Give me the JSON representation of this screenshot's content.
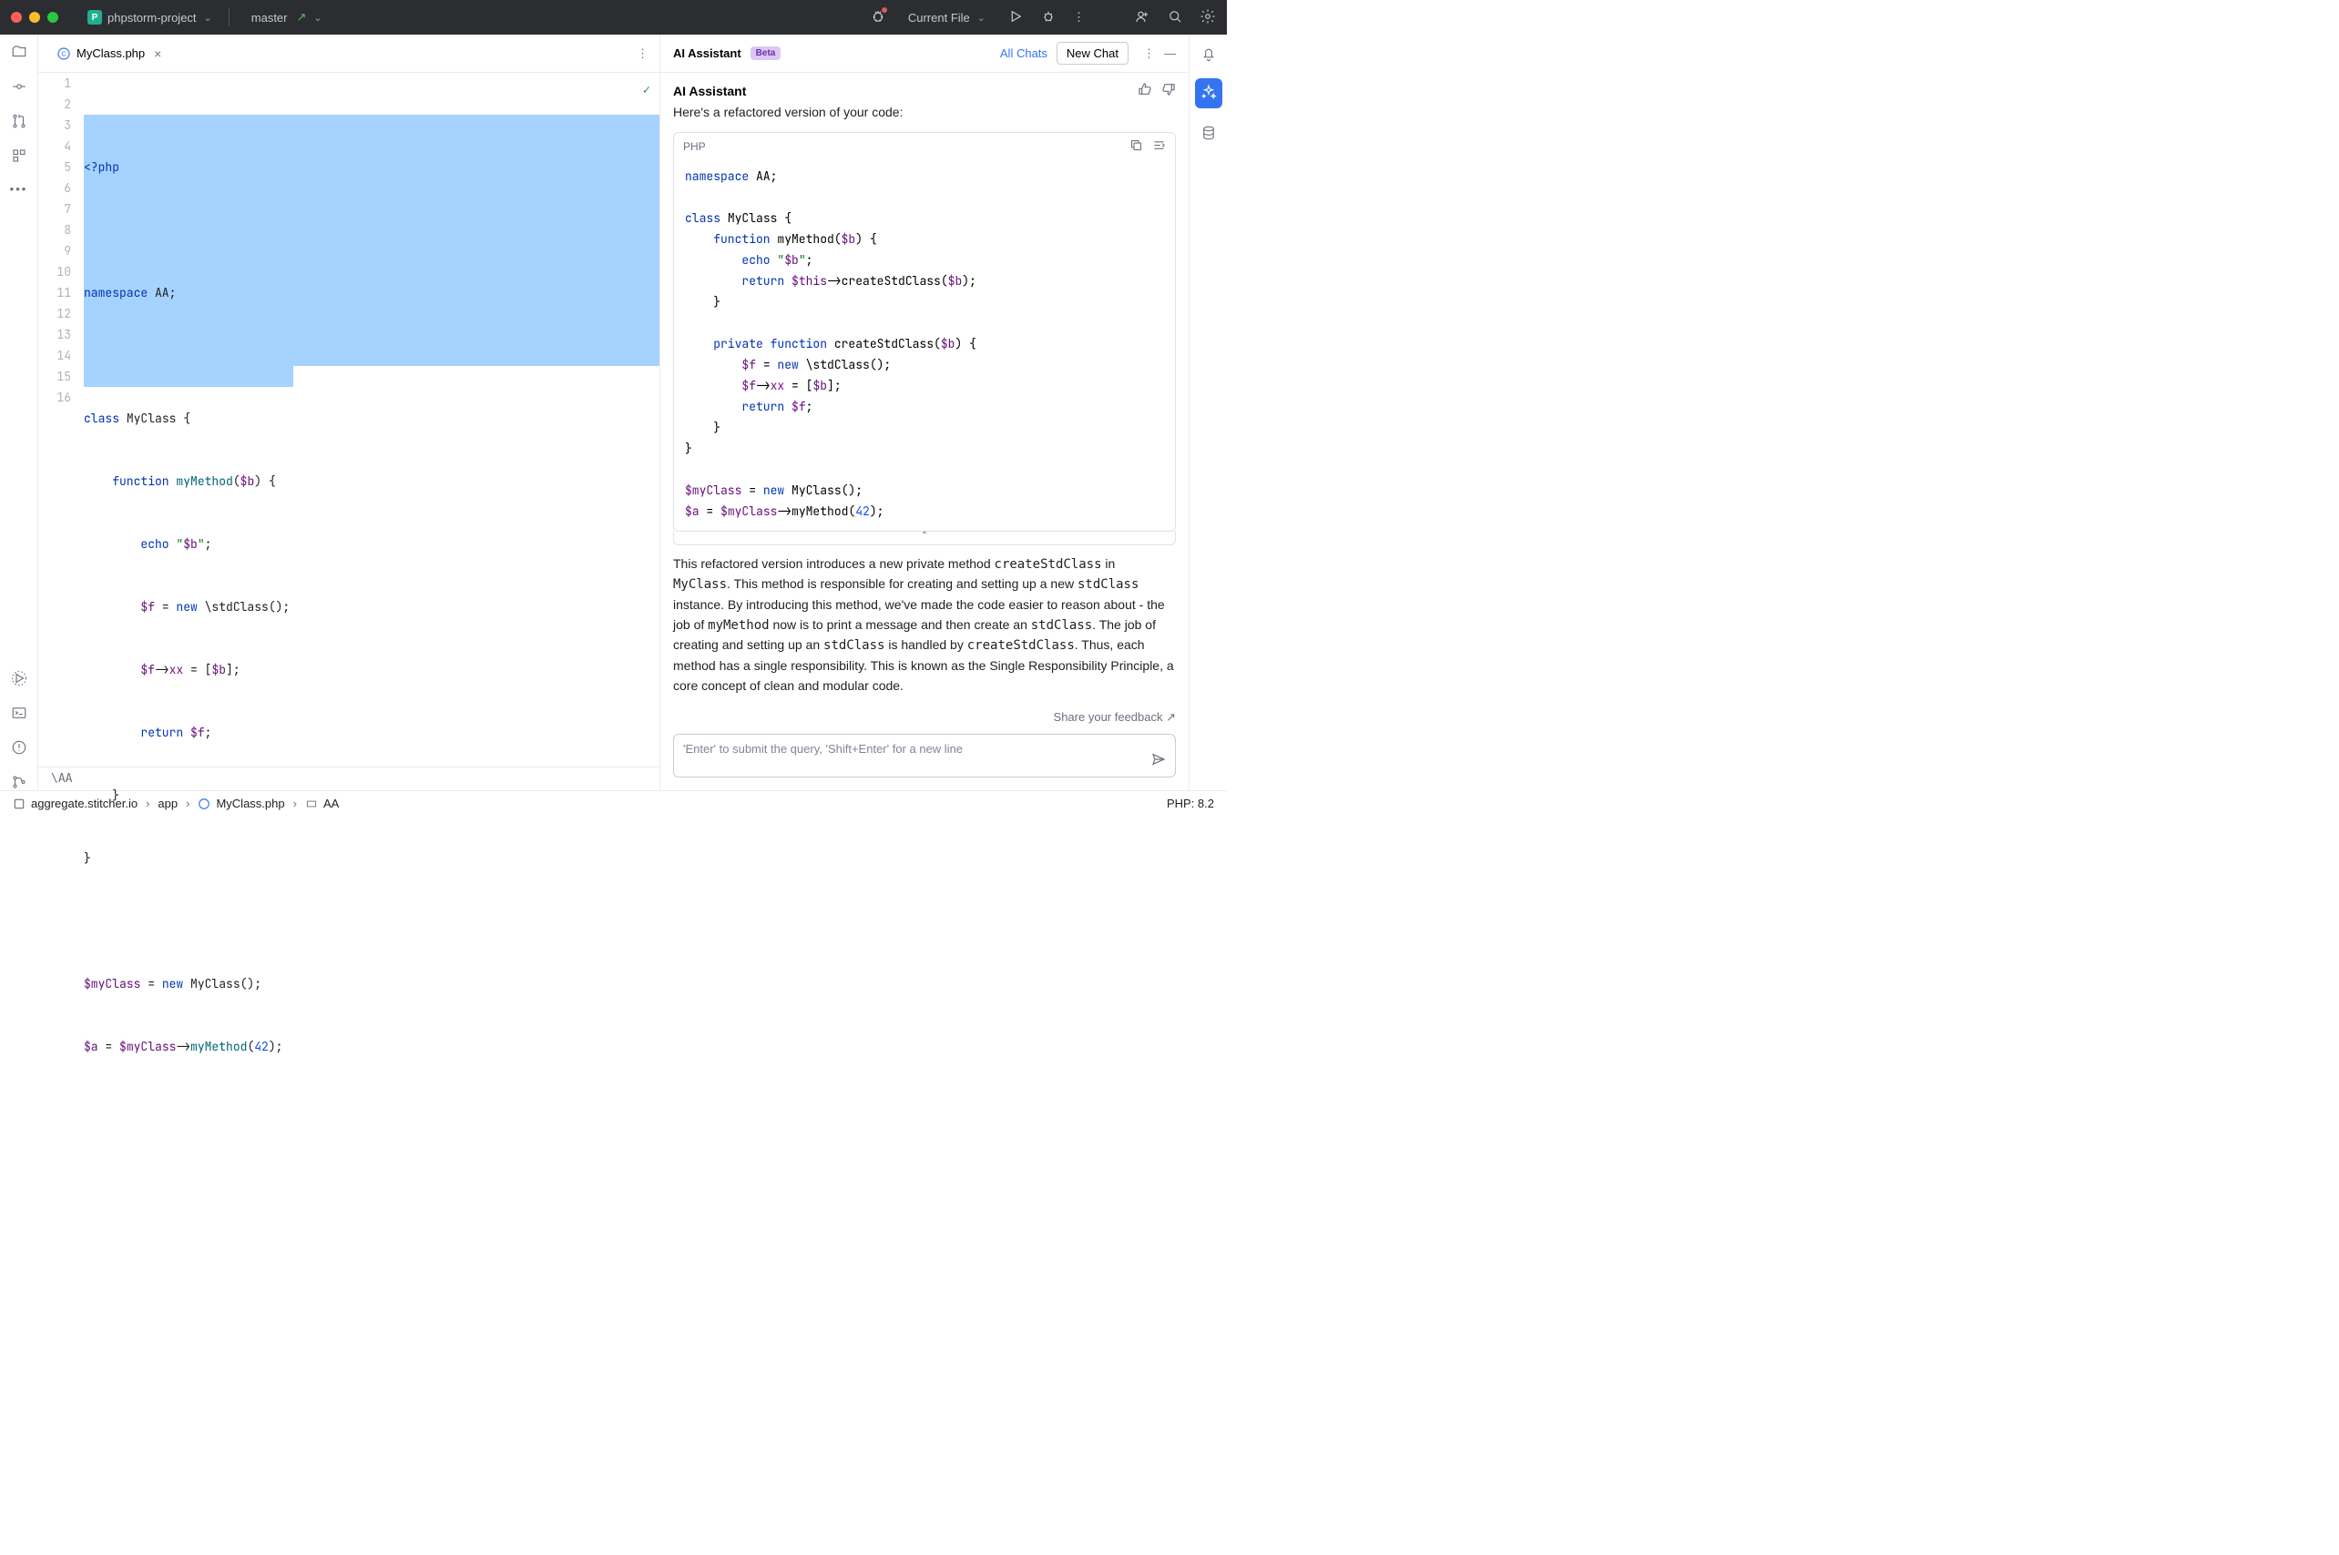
{
  "titlebar": {
    "project": "phpstorm-project",
    "branch": "master",
    "run_config": "Current File"
  },
  "editor": {
    "tab_filename": "MyClass.php",
    "line_numbers": [
      "1",
      "2",
      "3",
      "4",
      "5",
      "6",
      "7",
      "8",
      "9",
      "10",
      "11",
      "12",
      "13",
      "14",
      "15",
      "16"
    ],
    "code_lines": [
      {
        "t": "php_open",
        "text": "<?php"
      },
      {
        "t": "blank",
        "text": ""
      },
      {
        "t": "ns",
        "k": "namespace",
        "v": " AA;"
      },
      {
        "t": "blank",
        "text": ""
      },
      {
        "t": "classdecl",
        "k": "class",
        "name": " MyClass ",
        "brace": "{"
      },
      {
        "t": "funcdecl",
        "indent": "    ",
        "k": "function",
        "name": " myMethod",
        "args": "($b) {",
        "argvar": "$b"
      },
      {
        "t": "echo",
        "indent": "        ",
        "k": "echo",
        "q": "\"",
        "s": "$b",
        "q2": "\"",
        "end": ";"
      },
      {
        "t": "assign_new",
        "indent": "        ",
        "lhs": "$f",
        "eq": " = ",
        "new": "new",
        "rhs": " \\stdClass();"
      },
      {
        "t": "propset",
        "indent": "        ",
        "lhs": "$f",
        "arrow": "->",
        "prop": "xx",
        "eq": " = [",
        "v": "$b",
        "end": "];"
      },
      {
        "t": "ret",
        "indent": "        ",
        "k": "return ",
        "v": "$f",
        "end": ";"
      },
      {
        "t": "brace",
        "indent": "    ",
        "text": "}"
      },
      {
        "t": "brace",
        "indent": "",
        "text": "}"
      },
      {
        "t": "blank",
        "text": ""
      },
      {
        "t": "inst",
        "lhs": "$myClass",
        "eq": " = ",
        "new": "new",
        "rhs": " MyClass();"
      },
      {
        "t": "call",
        "lhs": "$a",
        "eq": " = ",
        "obj": "$myClass",
        "arrow": "->",
        "fn": "myMethod",
        "open": "(",
        "arg": "42",
        "close": ");"
      },
      {
        "t": "blank",
        "text": ""
      }
    ],
    "breadcrumb_path": "\\AA"
  },
  "ai": {
    "panel_title": "AI Assistant",
    "badge": "Beta",
    "all_chats": "All Chats",
    "new_chat": "New Chat",
    "msg_title": "AI Assistant",
    "intro": "Here's a refactored version of your code:",
    "code_lang": "PHP",
    "explanation_parts": {
      "p1": "This refactored version introduces a new private method ",
      "c1": "createStdClass",
      "p2": " in ",
      "c2": "MyClass",
      "p3": ". This method is responsible for creating and setting up a new ",
      "c3": "stdClass",
      "p4": " instance. By introducing this method, we've made the code easier to reason about - the job of ",
      "c4": "myMethod",
      "p5": " now is to print a message and then create an ",
      "c5": "stdClass",
      "p6": ". The job of creating and setting up an ",
      "c6": "stdClass",
      "p7": " is handled by ",
      "c7": "createStdClass",
      "p8": ". Thus, each method has a single responsibility. This is known as the Single Responsibility Principle, a core concept of clean and modular code."
    },
    "feedback": "Share your feedback ↗",
    "placeholder": "'Enter' to submit the query, 'Shift+Enter' for a new line",
    "refactored_code": {
      "ns": {
        "k": "namespace",
        "v": " AA;"
      },
      "class": {
        "k": "class",
        "name": " MyClass ",
        "brace": "{"
      },
      "m1": {
        "k": "function",
        "name": " myMethod",
        "open": "(",
        "arg": "$b",
        "close": ") {"
      },
      "m1_echo": {
        "k": "echo",
        "q1": "\"",
        "s": "$b",
        "q2": "\"",
        "end": ";"
      },
      "m1_ret": {
        "k": "return ",
        "this": "$this",
        "arrow": "->",
        "fn": "createStdClass",
        "open": "(",
        "arg": "$b",
        "close": ");"
      },
      "m2": {
        "k1": "private",
        "k2": " function",
        "name": " createStdClass",
        "open": "(",
        "arg": "$b",
        "close": ") {"
      },
      "m2_new": {
        "lhs": "$f",
        "eq": " = ",
        "new": "new",
        "rhs": " \\stdClass();"
      },
      "m2_prop": {
        "lhs": "$f",
        "arrow": "->",
        "prop": "xx",
        "eq": " = [",
        "arg": "$b",
        "close": "];"
      },
      "m2_ret": {
        "k": "return ",
        "v": "$f",
        "end": ";"
      },
      "inst": {
        "lhs": "$myClass",
        "eq": " = ",
        "new": "new",
        "rhs": " MyClass();"
      },
      "call": {
        "lhs": "$a",
        "eq": " = ",
        "obj": "$myClass",
        "arrow": "->",
        "fn": "myMethod",
        "open": "(",
        "arg": "42",
        "close": ");"
      }
    }
  },
  "status": {
    "bc_repo": "aggregate.stitcher.io",
    "bc_app": "app",
    "bc_file": "MyClass.php",
    "bc_ns": "AA",
    "php": "PHP: 8.2"
  }
}
